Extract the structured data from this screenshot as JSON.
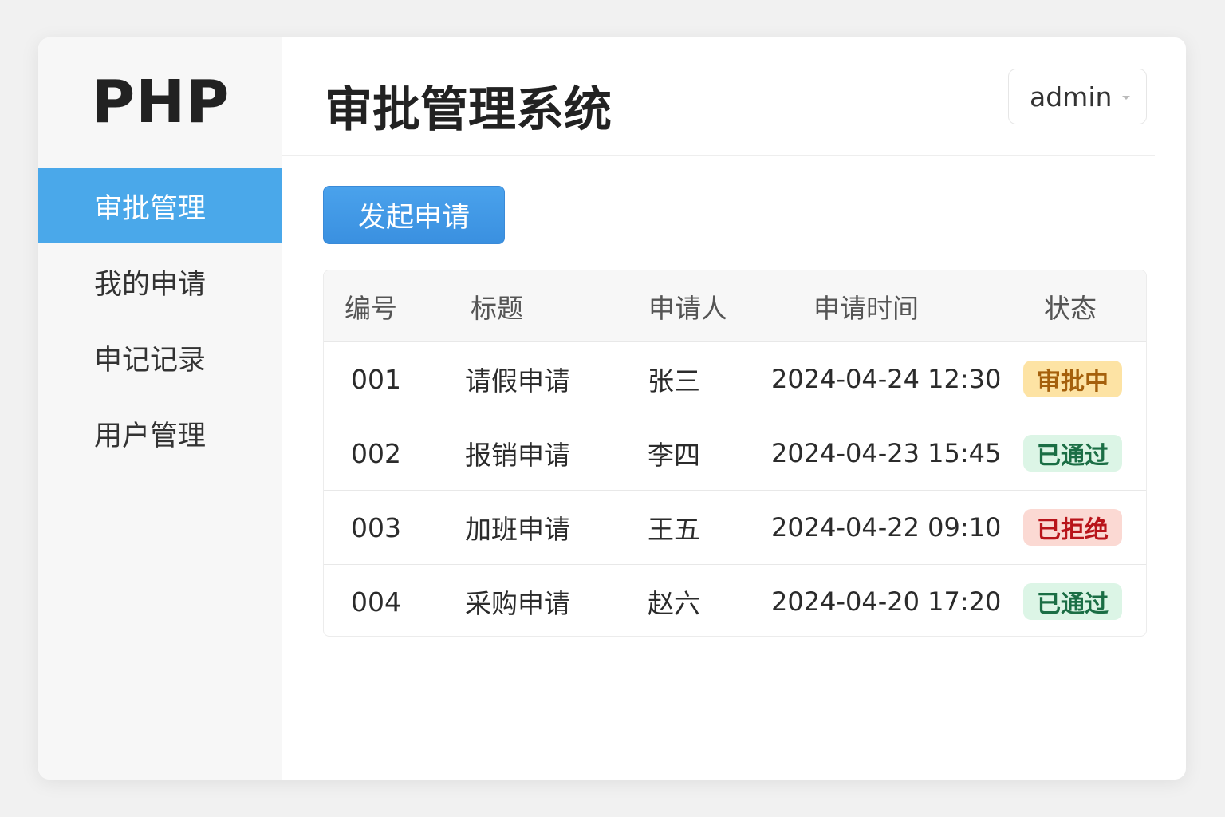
{
  "sidebar": {
    "logo": "PHP",
    "items": [
      {
        "label": "审批管理",
        "active": true
      },
      {
        "label": "我的申请"
      },
      {
        "label": "申记记录"
      },
      {
        "label": "用户管理"
      }
    ]
  },
  "header": {
    "title": "审批管理系统",
    "user": "admin",
    "user_menu_icon": "caret-down-icon"
  },
  "toolbar": {
    "new_request": "发起申请"
  },
  "table": {
    "columns": [
      "编号",
      "标题",
      "申请人",
      "申请时间",
      "状态"
    ],
    "rows": [
      {
        "id": "001",
        "title": "请假申请",
        "applicant": "张三",
        "time": "2024-04-24 12:30",
        "status": "审批中"
      },
      {
        "id": "002",
        "title": "报销申请",
        "applicant": "李四",
        "time": "2024-04-23 15:45",
        "status": "已通过"
      },
      {
        "id": "003",
        "title": "加班申请",
        "applicant": "王五",
        "time": "2024-04-22 09:10",
        "status": "已拒绝"
      },
      {
        "id": "004",
        "title": "采购申请",
        "applicant": "赵六",
        "time": "2024-04-20 17:20",
        "status": "已通过"
      }
    ]
  },
  "colors": {
    "accent": "#4aa8ea",
    "pending_bg": "#fde3a4",
    "pending_fg": "#a5600c",
    "approved_bg": "#dcf5e6",
    "approved_fg": "#1b6e45",
    "rejected_bg": "#fbd9d3",
    "rejected_fg": "#b8141a"
  }
}
